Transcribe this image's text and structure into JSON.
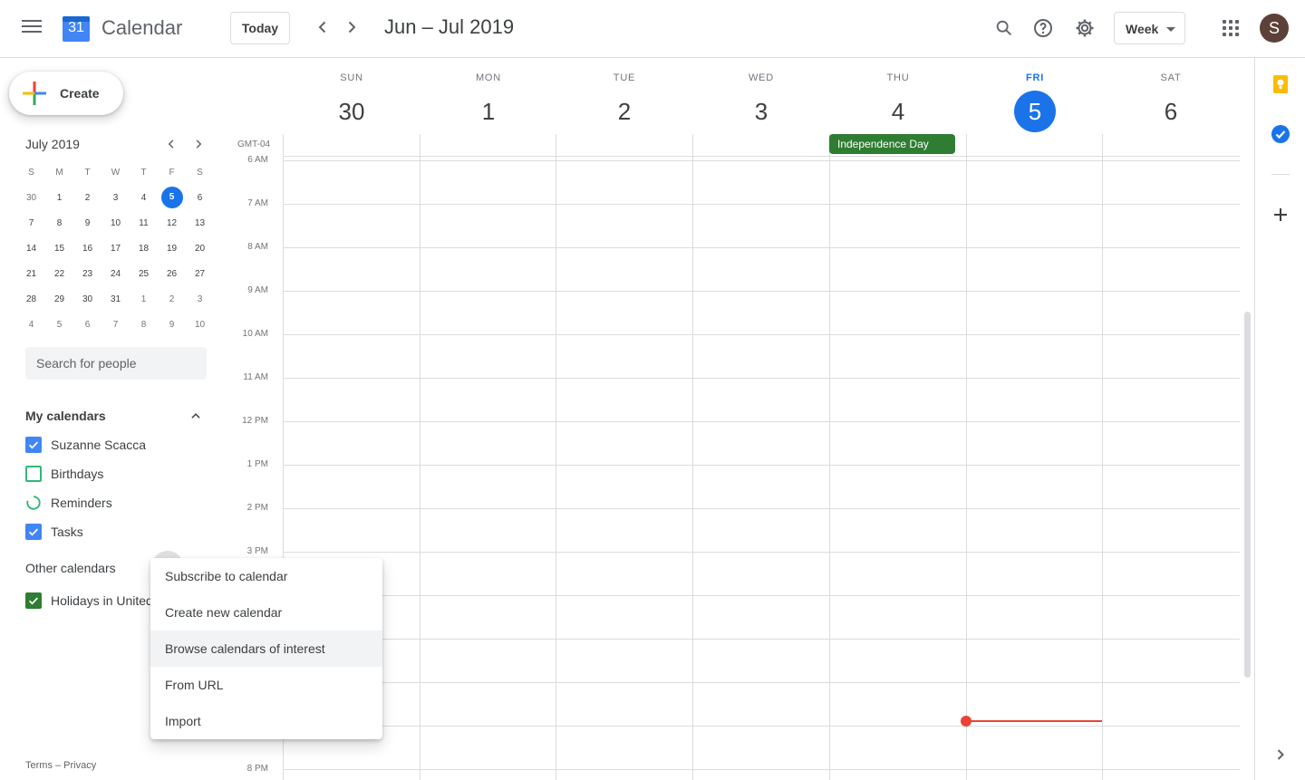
{
  "header": {
    "app_title": "Calendar",
    "logo_day": "31",
    "today_label": "Today",
    "date_range": "Jun – Jul 2019",
    "view_label": "Week",
    "avatar_initial": "S"
  },
  "sidebar": {
    "create_label": "Create",
    "mini_calendar": {
      "title": "July 2019",
      "weekday_heads": [
        "S",
        "M",
        "T",
        "W",
        "T",
        "F",
        "S"
      ],
      "weeks": [
        [
          "30",
          "1",
          "2",
          "3",
          "4",
          "5",
          "6"
        ],
        [
          "7",
          "8",
          "9",
          "10",
          "11",
          "12",
          "13"
        ],
        [
          "14",
          "15",
          "16",
          "17",
          "18",
          "19",
          "20"
        ],
        [
          "21",
          "22",
          "23",
          "24",
          "25",
          "26",
          "27"
        ],
        [
          "28",
          "29",
          "30",
          "31",
          "1",
          "2",
          "3"
        ],
        [
          "4",
          "5",
          "6",
          "7",
          "8",
          "9",
          "10"
        ]
      ],
      "today": "5"
    },
    "search_placeholder": "Search for people",
    "my_calendars_title": "My calendars",
    "my_calendars": [
      {
        "label": "Suzanne Scacca",
        "checked": true,
        "color": "#4285f4"
      },
      {
        "label": "Birthdays",
        "checked": false,
        "color": "#33b679"
      },
      {
        "label": "Reminders",
        "checked": false,
        "color": "#33b679"
      },
      {
        "label": "Tasks",
        "checked": true,
        "color": "#4285f4"
      }
    ],
    "other_calendars_title": "Other calendars",
    "other_calendars": [
      {
        "label": "Holidays in United",
        "checked": true,
        "color": "#2e7d32"
      }
    ],
    "footer": "Terms – Privacy"
  },
  "week": {
    "timezone": "GMT-04",
    "days": [
      {
        "dow": "SUN",
        "num": "30"
      },
      {
        "dow": "MON",
        "num": "1"
      },
      {
        "dow": "TUE",
        "num": "2"
      },
      {
        "dow": "WED",
        "num": "3"
      },
      {
        "dow": "THU",
        "num": "4"
      },
      {
        "dow": "FRI",
        "num": "5"
      },
      {
        "dow": "SAT",
        "num": "6"
      }
    ],
    "hours": [
      "6 AM",
      "7 AM",
      "8 AM",
      "9 AM",
      "10 AM",
      "11 AM",
      "12 PM",
      "1 PM",
      "2 PM",
      "3 PM",
      "8 PM"
    ],
    "allday_event": "Independence Day"
  },
  "menu": {
    "items": [
      "Subscribe to calendar",
      "Create new calendar",
      "Browse calendars of interest",
      "From URL",
      "Import"
    ]
  },
  "colors": {
    "accent": "#1a73e8",
    "event_green": "#2e7d32",
    "now_red": "#ea4335"
  }
}
